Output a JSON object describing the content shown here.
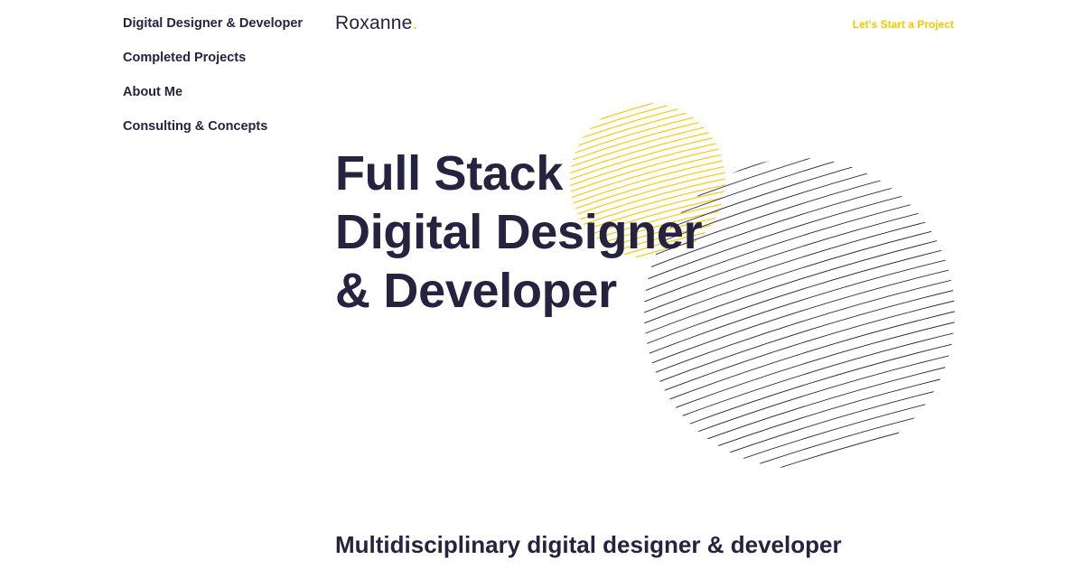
{
  "nav": {
    "items": [
      {
        "label": "Digital Designer & Developer"
      },
      {
        "label": "Completed Projects"
      },
      {
        "label": "About Me"
      },
      {
        "label": "Consulting & Concepts"
      }
    ]
  },
  "header": {
    "logo_text": "Roxanne",
    "logo_dot": ".",
    "cta_label": "Let's Start a Project"
  },
  "hero": {
    "title_lines": [
      "Full Stack",
      "Digital Designer",
      "& Developer"
    ]
  },
  "intro": {
    "subtitle": "Multidisciplinary digital designer & developer"
  },
  "colors": {
    "text": "#25233f",
    "accent": "#f5c800",
    "background": "#ffffff"
  },
  "decorations": {
    "circles": [
      "yellow-line-circle",
      "navy-line-circle"
    ]
  }
}
